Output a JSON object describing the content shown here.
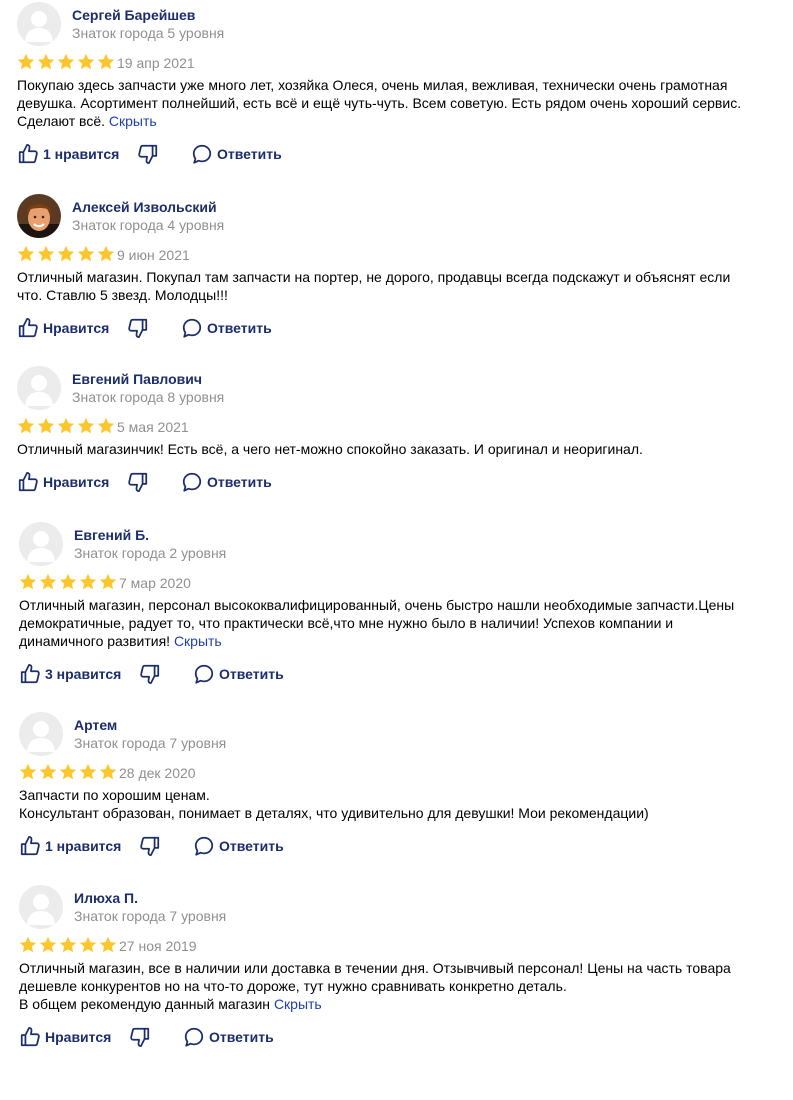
{
  "colors": {
    "author": "#1c2d6b",
    "meta": "#909090",
    "star": "#fcc72e",
    "link": "#1f3fae"
  },
  "reviews": [
    {
      "author": "Сергей Барейшев",
      "level": "Знаток города 5 уровня",
      "avatar": "default",
      "rating": 5,
      "date": "19 апр 2021",
      "lines": [
        "Покупаю здесь запчасти уже много лет, хозяйка Олеся, очень милая, вежливая, технически очень грамотная",
        "девушка. Асортимент полнейший, есть всё и ещё чуть-чуть. Всем советую. Есть рядом очень хороший сервис.",
        "Сделают всё."
      ],
      "hide_label": "Скрыть",
      "like_label": "1 нравится",
      "reply_label": "Ответить"
    },
    {
      "author": "Алексей Извольский",
      "level": "Знаток города 4 уровня",
      "avatar": "photo",
      "rating": 5,
      "date": "9 июн 2021",
      "lines": [
        "Отличный магазин. Покупал там запчасти на портер, не дорого, продавцы всегда подскажут и объяснят если",
        "что. Ставлю 5 звезд. Молодцы!!!"
      ],
      "hide_label": "",
      "like_label": "Нравится",
      "reply_label": "Ответить"
    },
    {
      "author": "Евгений Павлович",
      "level": "Знаток города 8 уровня",
      "avatar": "default",
      "rating": 5,
      "date": "5 мая 2021",
      "lines": [
        "Отличный магазинчик! Есть всё, а чего нет-можно спокойно заказать. И оригинал и неоригинал."
      ],
      "hide_label": "",
      "like_label": "Нравится",
      "reply_label": "Ответить"
    },
    {
      "author": "Евгений Б.",
      "level": "Знаток города 2 уровня",
      "avatar": "default",
      "rating": 5,
      "date": "7 мар 2020",
      "lines": [
        "Отличный магазин, персонал высококвалифицированный, очень быстро нашли необходимые запчасти.Цены",
        "демократичные, радует то, что практически всё,что мне нужно было в наличии! Успехов компании и",
        "динамичного развития!"
      ],
      "hide_label": "Скрыть",
      "like_label": "3 нравится",
      "reply_label": "Ответить"
    },
    {
      "author": "Артем",
      "level": "Знаток города 7 уровня",
      "avatar": "default",
      "rating": 5,
      "date": "28 дек 2020",
      "lines": [
        "Запчасти по хорошим ценам.",
        "Консультант образован, понимает в деталях, что удивительно для девушки! Мои рекомендации)"
      ],
      "hide_label": "",
      "like_label": "1 нравится",
      "reply_label": "Ответить"
    },
    {
      "author": "Илюха П.",
      "level": "Знаток города 7 уровня",
      "avatar": "default",
      "rating": 5,
      "date": "27 ноя 2019",
      "lines": [
        "Отличный магазин, все в наличии или доставка в течении дня. Отзывчивый персонал! Цены на часть товара",
        "дешевле конкурентов но на что-то дороже, тут нужно сравнивать конкретно деталь.",
        "В общем рекомендую данный магазин"
      ],
      "hide_label": "Скрыть",
      "like_label": "Нравится",
      "reply_label": "Ответить"
    }
  ]
}
